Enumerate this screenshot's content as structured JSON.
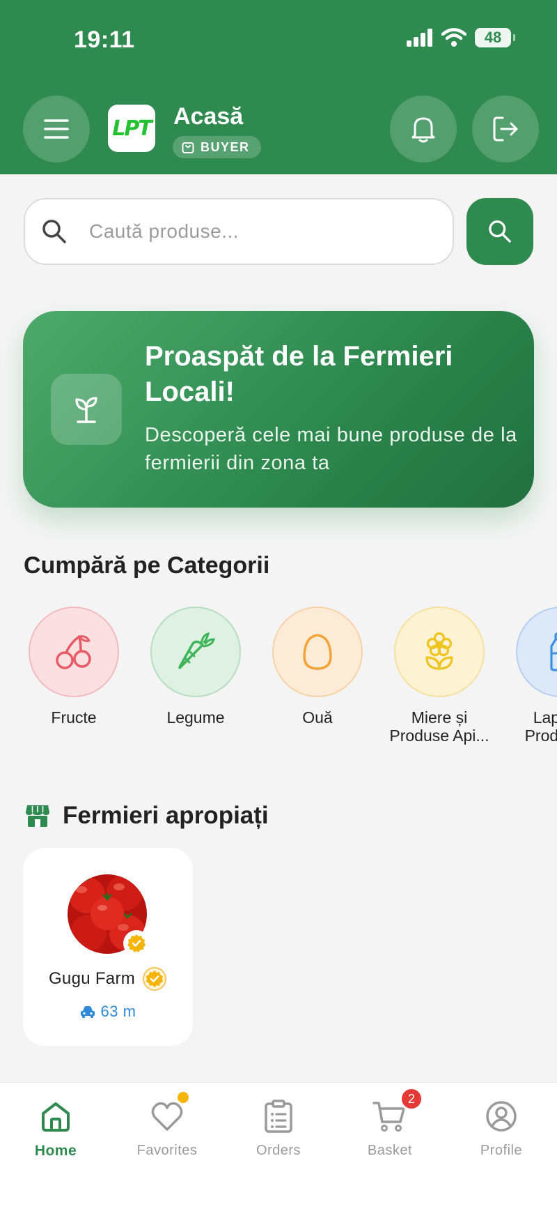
{
  "status_bar": {
    "time": "19:11",
    "battery": "48"
  },
  "header": {
    "title": "Acasă",
    "role": "BUYER",
    "logo_text": "LPT"
  },
  "search": {
    "placeholder": "Caută produse..."
  },
  "banner": {
    "title": "Proaspăt de la Fermieri Locali!",
    "subtitle": "Descoperă cele mai bune produse de la fermierii din zona ta"
  },
  "categories": {
    "title": "Cumpără pe Categorii",
    "items": [
      {
        "label": "Fructe",
        "icon": "cherry-icon",
        "color": "#e85a66"
      },
      {
        "label": "Legume",
        "icon": "carrot-icon",
        "color": "#3fb55a"
      },
      {
        "label": "Ouă",
        "icon": "egg-icon",
        "color": "#f4a338"
      },
      {
        "label": "Miere și Produse Api...",
        "icon": "flower-icon",
        "color": "#f0c420"
      },
      {
        "label": "Lapte și Produse...",
        "icon": "milk-bottle-icon",
        "color": "#3a8fe0"
      }
    ]
  },
  "farmers": {
    "title": "Fermieri apropiați",
    "items": [
      {
        "name": "Gugu Farm",
        "distance": "63 m",
        "verified": true
      }
    ]
  },
  "nav": {
    "items": [
      {
        "label": "Home",
        "active": true
      },
      {
        "label": "Favorites"
      },
      {
        "label": "Orders"
      },
      {
        "label": "Basket",
        "badge": "2"
      },
      {
        "label": "Profile"
      }
    ]
  },
  "colors": {
    "primary": "#2e8a4f",
    "accent": "#f5b40a",
    "badge": "#e53935",
    "distance": "#2e8ad8"
  }
}
